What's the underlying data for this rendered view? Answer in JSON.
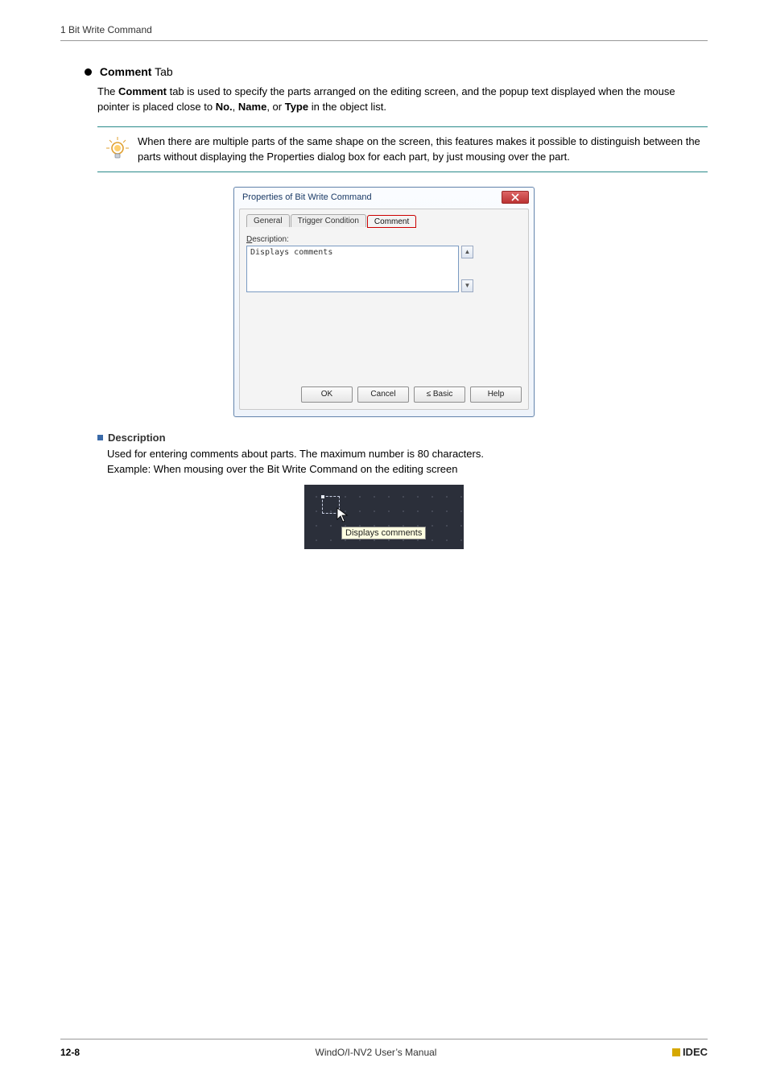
{
  "header": {
    "breadcrumb": "1 Bit Write Command"
  },
  "section": {
    "bullet_title_strong": "Comment",
    "bullet_title_rest": " Tab",
    "intro_1": "The ",
    "intro_strong1": "Comment",
    "intro_2": " tab is used to specify the parts arranged on the editing screen, and the popup text displayed when the mouse pointer is placed close to ",
    "intro_strong2": "No.",
    "intro_3": ", ",
    "intro_strong3": "Name",
    "intro_4": ", or ",
    "intro_strong4": "Type",
    "intro_5": " in the object list."
  },
  "tip": {
    "text": "When there are multiple parts of the same shape on the screen, this features makes it possible to distinguish between the parts without displaying the Properties dialog box for each part, by just mousing over the part."
  },
  "dialog": {
    "title": "Properties of Bit Write Command",
    "tabs": {
      "general": "General",
      "trigger": "Trigger Condition",
      "comment": "Comment"
    },
    "desc_label_underline": "D",
    "desc_label_rest": "escription:",
    "textarea_value": "Displays comments",
    "buttons": {
      "ok": "OK",
      "cancel": "Cancel",
      "basic": "≤ Basic",
      "help": "Help"
    }
  },
  "description": {
    "heading": "Description",
    "line1": "Used for entering comments about parts. The maximum number is 80 characters.",
    "line2": "Example: When mousing over the Bit Write Command on the editing screen",
    "tooltip_text": "Displays comments"
  },
  "footer": {
    "page": "12-8",
    "manual": "WindO/I-NV2 User’s Manual",
    "brand": "IDEC"
  }
}
